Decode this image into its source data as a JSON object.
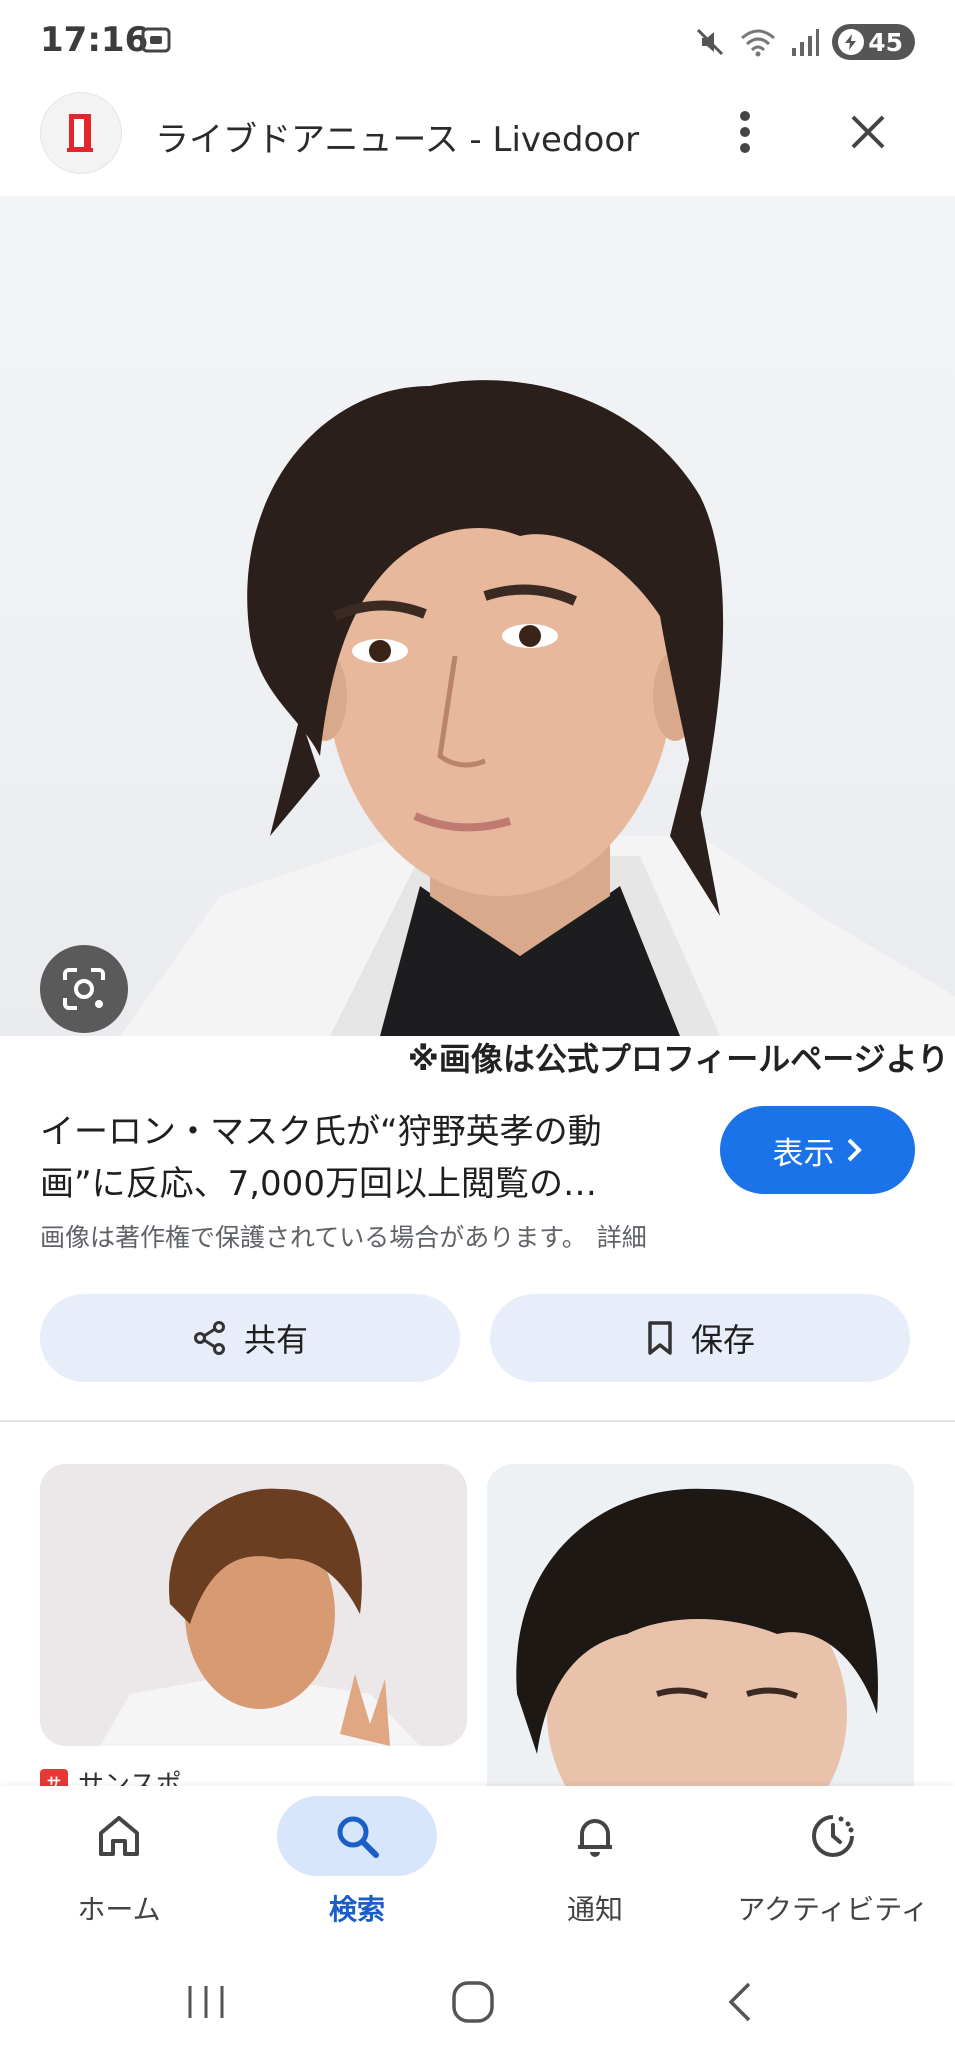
{
  "status_bar": {
    "time": "17:16",
    "battery": "45",
    "icons": [
      "screenshot-icon",
      "mute-icon",
      "wifi-icon",
      "signal-icon",
      "battery-icon"
    ]
  },
  "header": {
    "site_title": "ライブドアニュース - Livedoor",
    "logo_icon": "livedoor-logo",
    "more_icon": "more-vert-icon",
    "close_icon": "close-icon"
  },
  "hero": {
    "caption": "※画像は公式プロフィールページより",
    "lens_icon": "google-lens-icon"
  },
  "result": {
    "title": "イーロン・マスク氏が“狩野英孝の動画”に反応、7,000万回以上閲覧の…",
    "view_label": "表示",
    "copyright": "画像は著作権で保護されている場合があります。",
    "details_label": "詳細"
  },
  "actions": {
    "share_label": "共有",
    "save_label": "保存"
  },
  "related": {
    "source_name": "サンスポ",
    "source_icon_text": "サンスポ"
  },
  "bottom_nav": {
    "items": [
      {
        "label": "ホーム",
        "icon": "home-icon"
      },
      {
        "label": "検索",
        "icon": "search-icon",
        "active": true
      },
      {
        "label": "通知",
        "icon": "bell-icon"
      },
      {
        "label": "アクティビティ",
        "icon": "activity-icon"
      }
    ]
  },
  "colors": {
    "accent": "#1a73e8",
    "pill_bg": "#e8eef9",
    "active_nav_bg": "#d8e6fb"
  }
}
